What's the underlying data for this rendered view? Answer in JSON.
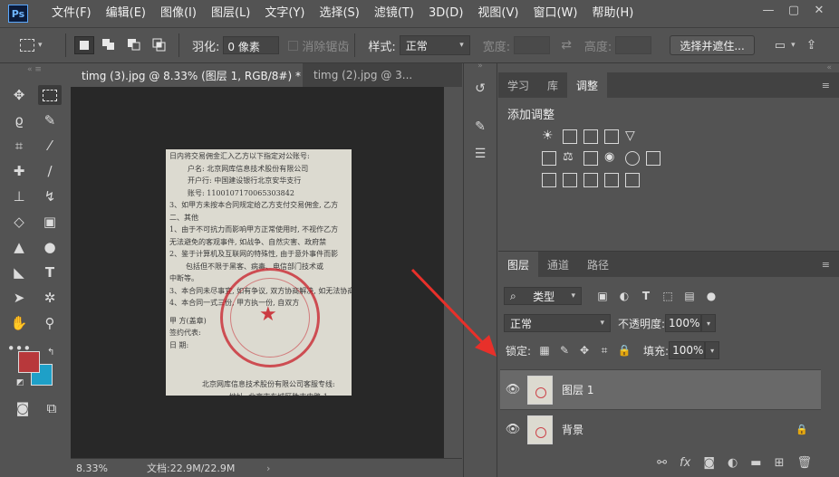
{
  "app": {
    "logo": "Ps",
    "menu": [
      "文件(F)",
      "编辑(E)",
      "图像(I)",
      "图层(L)",
      "文字(Y)",
      "选择(S)",
      "滤镜(T)",
      "3D(D)",
      "视图(V)",
      "窗口(W)",
      "帮助(H)"
    ],
    "window_buttons": {
      "minimize": "—",
      "restore": "▢",
      "close": "✕"
    }
  },
  "options": {
    "feather_label": "羽化:",
    "feather_value": "0 像素",
    "antialias_label": "消除锯齿",
    "style_label": "样式:",
    "style_value": "正常",
    "width_label": "宽度:",
    "height_label": "高度:",
    "select_mask_button": "选择并遮住..."
  },
  "doc_tabs": [
    {
      "title": "timg (3).jpg @ 8.33% (图层 1, RGB/8#) *",
      "close": "×"
    },
    {
      "title": "timg (2).jpg @ 3...",
      "close": "×"
    }
  ],
  "canvas": {
    "doc_lines": [
      "日内将交易佣金汇入乙方以下指定对公账号:",
      "户名: 北京网库信息技术股份有限公司",
      "开户行: 中国建设银行北京安华支行",
      "账号: 1100107170065303842",
      "3、如甲方未按本合同规定给乙方支付交易佣金, 乙方",
      "二、其他",
      "1、由于不可抗力而影响甲方正常使用时, 不视作乙方",
      "无法避免的客观事件, 如战争、自然灾害、政府禁",
      "2、鉴于计算机及互联网的特殊性, 由于意外事件而影",
      "包括但不限于黑客、病毒、电信部门技术或",
      "中断等。",
      "3、本合同未尽事宜, 如有争议, 双方协商解决, 如无法协商",
      "4、本合同一式三份, 甲方执一份, 自双方",
      "甲  方(盖章)",
      "签约代表:",
      "日  期:",
      "北京网库信息技术股份有限公司客服专线:",
      "地址: 北京市东城区胜古中路 1"
    ]
  },
  "status": {
    "zoom": "8.33%",
    "doc_info": "文档:22.9M/22.9M",
    "arrow": "›"
  },
  "adjust_panel": {
    "tabs": [
      "学习",
      "库",
      "调整"
    ],
    "active_tab": "调整",
    "title": "添加调整"
  },
  "layers_panel": {
    "tabs": [
      "图层",
      "通道",
      "路径"
    ],
    "active_tab": "图层",
    "filter_label": "类型",
    "blend_mode": "正常",
    "opacity_label": "不透明度:",
    "opacity_value": "100%",
    "lock_label": "锁定:",
    "fill_label": "填充:",
    "fill_value": "100%",
    "layers": [
      {
        "name": "图层 1",
        "selected": true,
        "locked": false
      },
      {
        "name": "背景",
        "selected": false,
        "locked": true
      }
    ],
    "footer_icons": [
      "link-icon",
      "fx-icon",
      "mask-icon",
      "adjustment-icon",
      "group-folder-icon",
      "new-layer-icon",
      "trash-icon"
    ]
  },
  "colors": {
    "foreground": "#b8383b",
    "background": "#1ea0c8",
    "accent_arrow": "#e8302a",
    "ui_bg": "#535353",
    "canvas_bg": "#282828"
  }
}
